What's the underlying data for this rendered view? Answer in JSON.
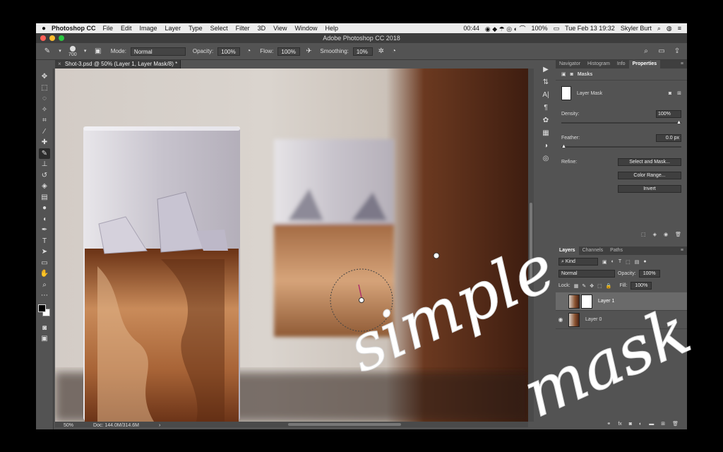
{
  "menubar": {
    "apple": "",
    "app_name": "Photoshop CC",
    "items": [
      "File",
      "Edit",
      "Image",
      "Layer",
      "Type",
      "Select",
      "Filter",
      "3D",
      "View",
      "Window",
      "Help"
    ],
    "battery_timer": "00:44",
    "battery": "100%",
    "datetime": "Tue Feb 13  19:32",
    "user": "Skyler Burt"
  },
  "window": {
    "title": "Adobe Photoshop CC 2018"
  },
  "options": {
    "brush_size": "700",
    "mode_label": "Mode:",
    "mode_value": "Normal",
    "opacity_label": "Opacity:",
    "opacity_value": "100%",
    "flow_label": "Flow:",
    "flow_value": "100%",
    "smoothing_label": "Smoothing:",
    "smoothing_value": "10%"
  },
  "document": {
    "tab_title": "Shot-3.psd @ 50% (Layer 1, Layer Mask/8) *",
    "zoom": "50%",
    "doc_size": "Doc: 144.0M/314.6M"
  },
  "properties_panel": {
    "tabs": [
      "Navigator",
      "Histogram",
      "Info",
      "Properties"
    ],
    "active_tab": "Properties",
    "section": "Masks",
    "mask_name": "Layer Mask",
    "density_label": "Density:",
    "density_value": "100%",
    "feather_label": "Feather:",
    "feather_value": "0.0 px",
    "refine_label": "Refine:",
    "btn_select_mask": "Select and Mask...",
    "btn_color_range": "Color Range...",
    "btn_invert": "Invert"
  },
  "layers_panel": {
    "tabs": [
      "Layers",
      "Channels",
      "Paths"
    ],
    "active_tab": "Layers",
    "filter": "Kind",
    "blend_mode": "Normal",
    "opacity_label": "Opacity:",
    "opacity_value": "100%",
    "lock_label": "Lock:",
    "fill_label": "Fill:",
    "fill_value": "100%",
    "layers": [
      {
        "name": "Layer 1",
        "selected": true,
        "visible": true
      },
      {
        "name": "Layer 0",
        "selected": false,
        "visible": true
      }
    ]
  },
  "overlay_text": {
    "line1": "simple",
    "line2": "mask"
  },
  "colors": {
    "accent": "#ffffff",
    "panel_bg": "#535353",
    "foreground": "#000000",
    "background": "#ffffff"
  }
}
